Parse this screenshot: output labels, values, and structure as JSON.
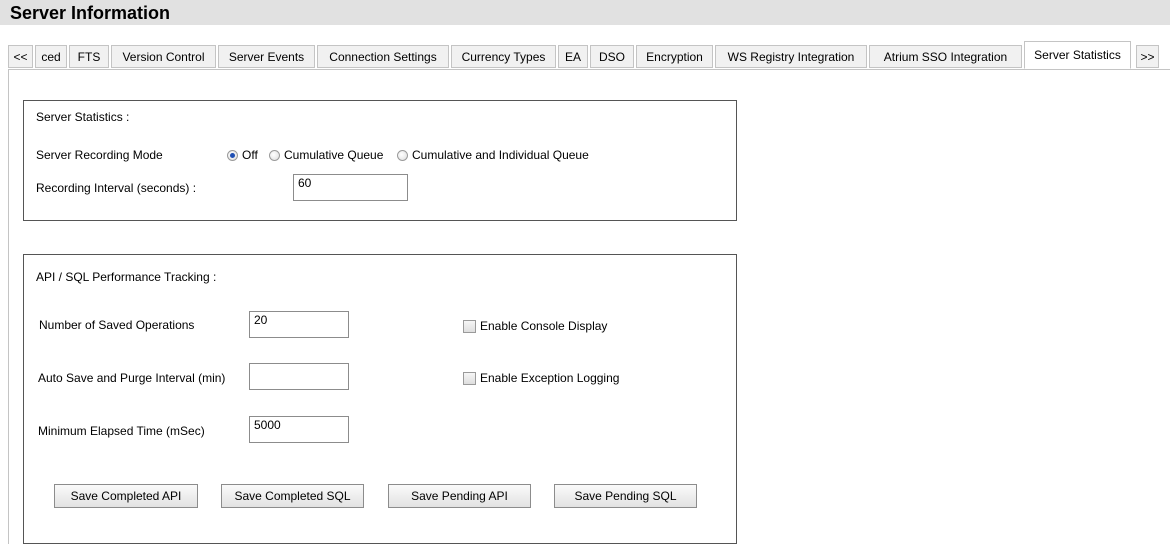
{
  "header": {
    "title": "Server Information"
  },
  "tabs": [
    {
      "label": "<<"
    },
    {
      "label": "ced"
    },
    {
      "label": "FTS"
    },
    {
      "label": "Version Control"
    },
    {
      "label": "Server Events"
    },
    {
      "label": "Connection Settings"
    },
    {
      "label": "Currency Types"
    },
    {
      "label": "EA"
    },
    {
      "label": "DSO"
    },
    {
      "label": "Encryption"
    },
    {
      "label": "WS Registry Integration"
    },
    {
      "label": "Atrium SSO Integration"
    },
    {
      "label": "Server Statistics",
      "active": true
    },
    {
      "label": ">>"
    }
  ],
  "server_statistics": {
    "heading": "Server Statistics :",
    "recording_mode_label": "Server Recording Mode",
    "recording_mode_options": [
      {
        "label": "Off",
        "selected": true
      },
      {
        "label": "Cumulative Queue",
        "selected": false
      },
      {
        "label": "Cumulative and Individual Queue",
        "selected": false
      }
    ],
    "interval_label": "Recording Interval (seconds) :",
    "interval_value": "60"
  },
  "performance_tracking": {
    "heading": "API / SQL Performance Tracking :",
    "saved_ops_label": "Number of Saved Operations",
    "saved_ops_value": "20",
    "purge_label": "Auto Save and Purge Interval (min)",
    "purge_value": "",
    "min_elapsed_label": "Minimum Elapsed Time (mSec)",
    "min_elapsed_value": "5000",
    "console_display_label": "Enable Console Display",
    "console_display_checked": false,
    "exception_logging_label": "Enable Exception Logging",
    "exception_logging_checked": false,
    "buttons": {
      "save_completed_api": "Save Completed API",
      "save_completed_sql": "Save Completed SQL",
      "save_pending_api": "Save Pending API",
      "save_pending_sql": "Save Pending SQL"
    }
  }
}
